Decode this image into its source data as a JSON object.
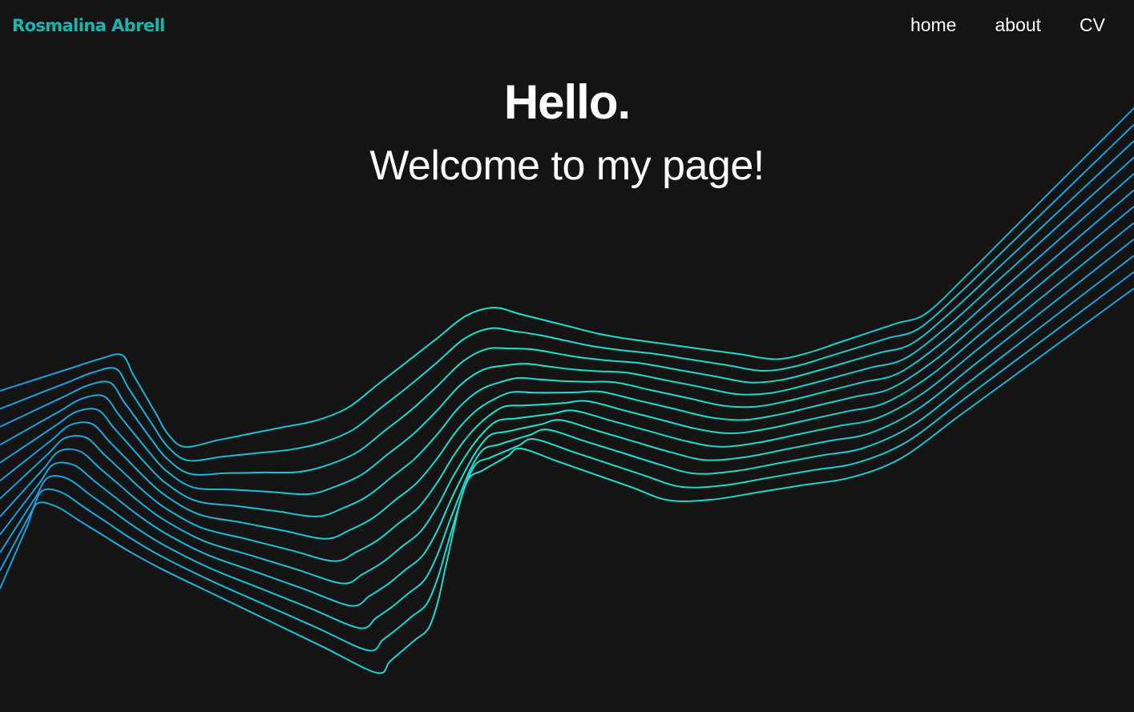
{
  "header": {
    "brand": "Rosmalina Abrell",
    "nav": [
      {
        "label": "home"
      },
      {
        "label": "about"
      },
      {
        "label": "CV"
      }
    ]
  },
  "hero": {
    "title": "Hello.",
    "subtitle": "Welcome to my page!"
  },
  "decoration": {
    "wave_color_start": "#1a9be0",
    "wave_color_mid": "#19e6cf",
    "wave_color_end": "#1a9be0",
    "background": "#141414"
  }
}
